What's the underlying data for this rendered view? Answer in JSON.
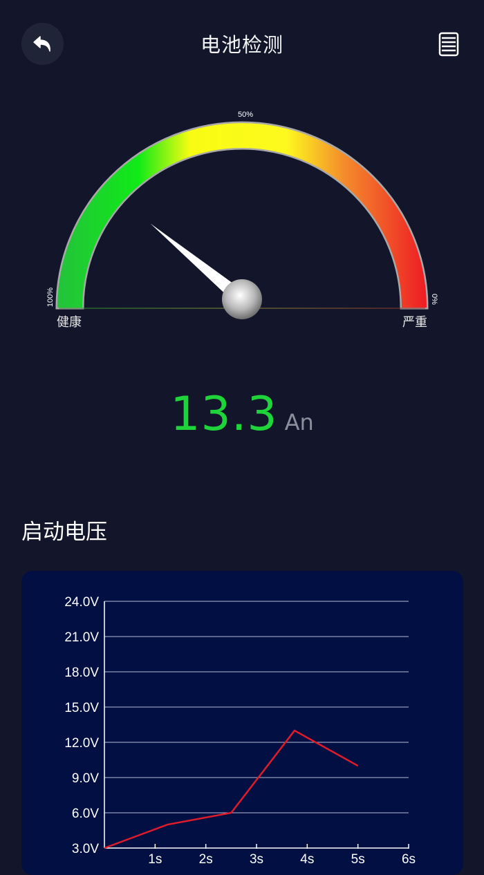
{
  "header": {
    "title": "电池检测"
  },
  "gauge": {
    "label_left": "健康",
    "label_right": "严重",
    "tick_top": "50%",
    "tick_left": "100%",
    "tick_right": "0%",
    "health_percent": 78,
    "colors": {
      "green": "#18d62a",
      "yellow": "#fef91c",
      "red": "#ec1e24"
    }
  },
  "reading": {
    "value": "13.3",
    "unit": "An"
  },
  "section": {
    "title": "启动电压"
  },
  "chart_data": {
    "type": "line",
    "x": [
      "1s",
      "2s",
      "3s",
      "4s",
      "5s",
      "6s"
    ],
    "ylim": [
      3,
      24
    ],
    "yticks": [
      "3.0V",
      "6.0V",
      "9.0V",
      "12.0V",
      "15.0V",
      "18.0V",
      "21.0V",
      "24.0V"
    ],
    "series": [
      {
        "color": "#e01b2a",
        "points": [
          {
            "x": 0.0,
            "y": 3.0
          },
          {
            "x": 1.25,
            "y": 5.0
          },
          {
            "x": 2.5,
            "y": 6.0
          },
          {
            "x": 3.75,
            "y": 13.0
          },
          {
            "x": 5.0,
            "y": 10.0
          }
        ]
      }
    ]
  }
}
